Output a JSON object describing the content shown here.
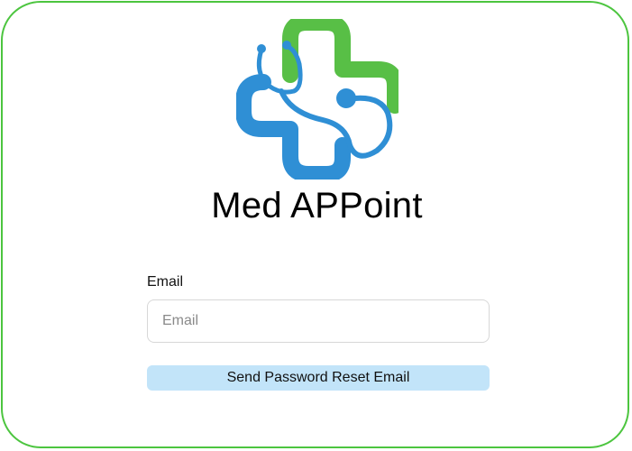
{
  "app": {
    "title": "Med APPoint"
  },
  "form": {
    "email_label": "Email",
    "email_placeholder": "Email",
    "email_value": "",
    "submit_label": "Send Password Reset Email"
  },
  "colors": {
    "border_accent": "#4cc53f",
    "logo_green": "#58bf46",
    "logo_blue": "#2f8fd5",
    "button_bg": "#c2e4f9"
  },
  "icons": {
    "logo": "medical-cross-stethoscope-icon"
  }
}
